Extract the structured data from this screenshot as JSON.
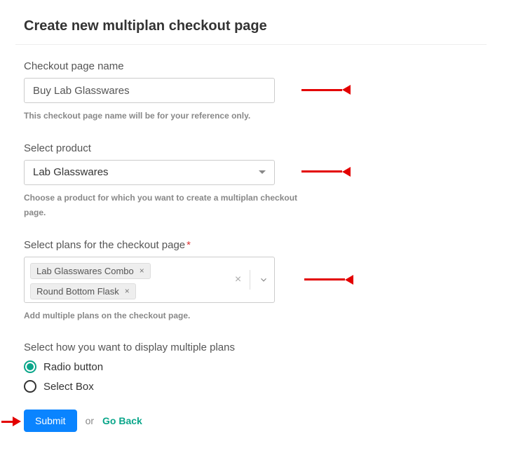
{
  "title": "Create new multiplan checkout page",
  "fields": {
    "name": {
      "label": "Checkout page name",
      "value": "Buy Lab Glasswares",
      "helper": "This checkout page name will be for your reference only."
    },
    "product": {
      "label": "Select product",
      "selected": "Lab Glasswares",
      "helper": "Choose a product for which you want to create a multiplan checkout page."
    },
    "plans": {
      "label": "Select plans for the checkout page",
      "tags": [
        "Lab Glasswares Combo",
        "Round Bottom Flask"
      ],
      "helper": "Add multiple plans on the checkout page."
    },
    "display": {
      "label": "Select how you want to display multiple plans",
      "options": [
        "Radio button",
        "Select Box"
      ],
      "selected": "Radio button"
    }
  },
  "actions": {
    "submit": "Submit",
    "or": "or",
    "back": "Go Back"
  }
}
